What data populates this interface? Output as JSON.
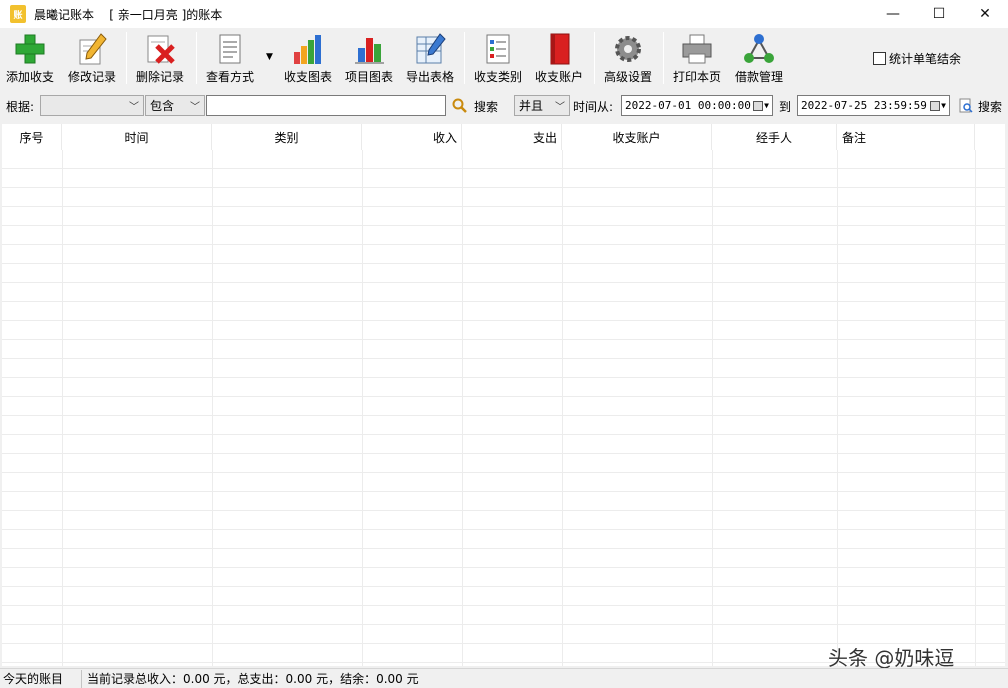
{
  "window": {
    "app_icon_text": "账",
    "title": "晨曦记账本    [ 亲一口月亮 ]的账本",
    "minimize": "—",
    "maximize": "☐",
    "close": "✕"
  },
  "toolbar": {
    "add": "添加收支",
    "edit": "修改记录",
    "delete": "删除记录",
    "view": "查看方式",
    "chart_income": "收支图表",
    "chart_item": "项目图表",
    "export": "导出表格",
    "category": "收支类别",
    "account": "收支账户",
    "settings": "高级设置",
    "print": "打印本页",
    "loan": "借款管理",
    "stat_checkbox": "统计单笔结余"
  },
  "filter": {
    "basis_label": "根据:",
    "basis_value": "",
    "match_value": "包含",
    "search_text": "",
    "search_label": "搜索",
    "logic_value": "并且",
    "time_from_label": "时间从:",
    "time_from": "2022-07-01 00:00:00",
    "to_label": "到",
    "time_to": "2022-07-25 23:59:59",
    "search2_label": "搜索"
  },
  "grid": {
    "columns": [
      "序号",
      "时间",
      "类别",
      "收入",
      "支出",
      "收支账户",
      "经手人",
      "备注"
    ]
  },
  "watermark": "头条 @奶味逗",
  "status": {
    "today": "今天的账目",
    "summary": "当前记录总收入：0.00 元，总支出：0.00 元，结余：0.00 元"
  },
  "colors": {
    "add_green": "#2fa836",
    "delete_red": "#d92020",
    "accent_blue": "#2d6fd1"
  }
}
